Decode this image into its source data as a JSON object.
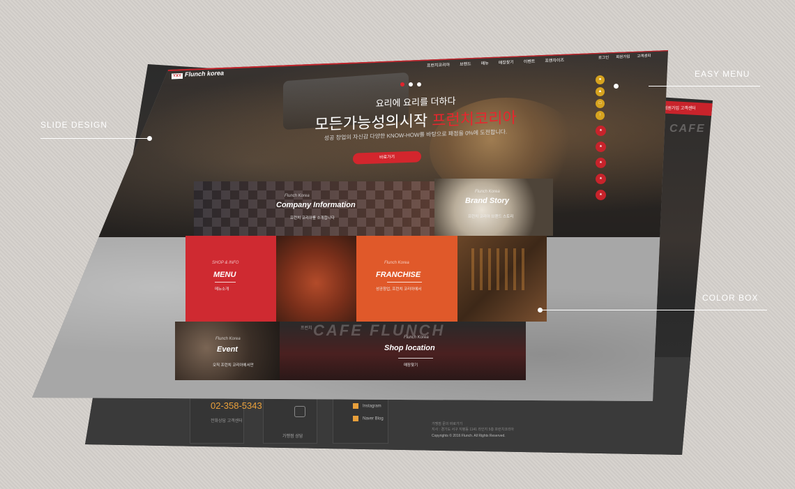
{
  "annotations": {
    "slide_design": "SLIDE DESIGN",
    "easy_menu": "EASY MENU",
    "color_box": "COLOR BOX"
  },
  "header": {
    "logo_mark": "YXY",
    "logo_text": "Flunch korea",
    "nav": [
      "프런치코리아",
      "브랜드",
      "메뉴",
      "매장찾기",
      "이벤트",
      "프랜차이즈"
    ],
    "util": [
      "로그인",
      "회원가입",
      "고객센터"
    ]
  },
  "hero": {
    "kicker": "요리에 요리를 더하다",
    "title_main": "모든가능성의시작",
    "title_highlight": "프런치코리아",
    "desc": "성공 창업의 자신감 다양한 KNOW-HOW를 바탕으로 패점을 0%에 도전합니다.",
    "button": "바로가기"
  },
  "easy_menu": {
    "icons": [
      "lock-icon",
      "cart-icon",
      "calendar-icon",
      "arrow-up-icon"
    ],
    "red_items": [
      "brand-1",
      "brand-2",
      "brand-3",
      "brand-4",
      "brand-5"
    ]
  },
  "tiles": {
    "company": {
      "small": "Flunch Korea",
      "name": "Company Information",
      "desc": "프런치 코리아를 소개합니다"
    },
    "brand": {
      "small": "Flunch Korea",
      "name": "Brand Story",
      "desc": "프런치 코리아 브랜드 스토리"
    },
    "menu": {
      "small": "SHOP & INFO",
      "name": "MENU",
      "desc": "메뉴소개"
    },
    "franchise": {
      "small": "Flunch Korea",
      "name": "FRANCHISE",
      "desc": "성공창업, 프런치 코리아에서"
    },
    "event": {
      "small": "Flunch Korea",
      "name": "Event",
      "desc": "오직 프런치 코리아에서만"
    },
    "shop": {
      "sign": "CAFE FLUNCH",
      "small": "Flunch Korea",
      "name": "Shop location",
      "desc": "매장찾기",
      "mini": "프런치"
    }
  },
  "back": {
    "menu": "회원가입  고객센터",
    "cafe": "CAFE",
    "footer": {
      "phone": "02-358-5343",
      "phone_sub": "전화상담 고객센터",
      "consult": "가맹점 상담",
      "sns": [
        "Instagram",
        "Naver Blog"
      ],
      "addr": "가맹점 문의 바로가기\n지사 : 경기도 서구 지평동 1141 라인지 5층 프런치코리아",
      "copy": "Copyrights © 2016 Flunch. All Rights Reserved."
    }
  },
  "colors": {
    "brand_red": "#c8232b",
    "orange": "#e0592a",
    "gold": "#d6a31f"
  }
}
